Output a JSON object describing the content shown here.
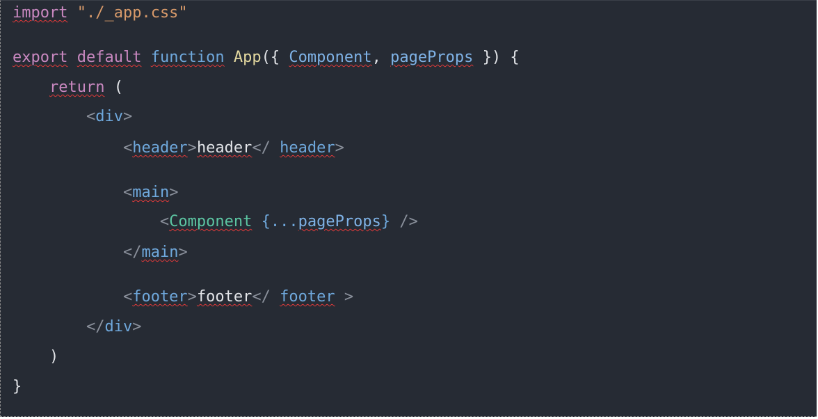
{
  "editor": {
    "colors": {
      "background": "#262b34",
      "keyword": "#c988c0",
      "function_name": "#e4d9a0",
      "string": "#d89a6a",
      "tag": "#6fa8dc",
      "component": "#5cc5a2",
      "punctuation": "#8a909b",
      "spellcheck_underline": "#e03a3a"
    },
    "lines": [
      {
        "tokens": [
          {
            "text": "import",
            "kind": "kw",
            "squiggle": true
          },
          {
            "text": " ",
            "kind": "plain"
          },
          {
            "text": "\"./_app.css\"",
            "kind": "str"
          }
        ]
      },
      {
        "tokens": []
      },
      {
        "tokens": [
          {
            "text": "export",
            "kind": "kw",
            "squiggle": true
          },
          {
            "text": " ",
            "kind": "plain"
          },
          {
            "text": "default",
            "kind": "kw",
            "squiggle": true
          },
          {
            "text": " ",
            "kind": "plain"
          },
          {
            "text": "function",
            "kind": "blue",
            "squiggle": true
          },
          {
            "text": " ",
            "kind": "plain"
          },
          {
            "text": "App",
            "kind": "fn"
          },
          {
            "text": "({ ",
            "kind": "plain"
          },
          {
            "text": "Component",
            "kind": "param",
            "squiggle": true
          },
          {
            "text": ", ",
            "kind": "plain"
          },
          {
            "text": "pageProps",
            "kind": "param",
            "squiggle": true
          },
          {
            "text": " }) {",
            "kind": "plain"
          }
        ]
      },
      {
        "tokens": [
          {
            "text": "    ",
            "kind": "plain"
          },
          {
            "text": "return",
            "kind": "kw",
            "squiggle": true
          },
          {
            "text": " (",
            "kind": "plain"
          }
        ]
      },
      {
        "tokens": [
          {
            "text": "        ",
            "kind": "plain"
          },
          {
            "text": "<",
            "kind": "punc"
          },
          {
            "text": "div",
            "kind": "blue"
          },
          {
            "text": ">",
            "kind": "punc"
          }
        ]
      },
      {
        "tokens": [
          {
            "text": "            ",
            "kind": "plain"
          },
          {
            "text": "<",
            "kind": "punc"
          },
          {
            "text": "header",
            "kind": "blue",
            "squiggle": true
          },
          {
            "text": ">",
            "kind": "punc"
          },
          {
            "text": "header",
            "kind": "plain",
            "squiggle": true
          },
          {
            "text": "</ ",
            "kind": "punc"
          },
          {
            "text": "header",
            "kind": "blue",
            "squiggle": true
          },
          {
            "text": ">",
            "kind": "punc"
          }
        ]
      },
      {
        "tokens": []
      },
      {
        "tokens": [
          {
            "text": "            ",
            "kind": "plain"
          },
          {
            "text": "<",
            "kind": "punc"
          },
          {
            "text": "main",
            "kind": "blue",
            "squiggle": true
          },
          {
            "text": ">",
            "kind": "punc"
          }
        ]
      },
      {
        "tokens": [
          {
            "text": "                ",
            "kind": "plain"
          },
          {
            "text": "<",
            "kind": "punc"
          },
          {
            "text": "Component",
            "kind": "comp",
            "squiggle": true
          },
          {
            "text": " ",
            "kind": "plain"
          },
          {
            "text": "{...",
            "kind": "blue"
          },
          {
            "text": "pageProps",
            "kind": "param",
            "squiggle": true
          },
          {
            "text": "}",
            "kind": "blue"
          },
          {
            "text": " />",
            "kind": "punc"
          }
        ]
      },
      {
        "tokens": [
          {
            "text": "            ",
            "kind": "plain"
          },
          {
            "text": "</",
            "kind": "punc"
          },
          {
            "text": "main",
            "kind": "blue",
            "squiggle": true
          },
          {
            "text": ">",
            "kind": "punc"
          }
        ]
      },
      {
        "tokens": []
      },
      {
        "tokens": [
          {
            "text": "            ",
            "kind": "plain"
          },
          {
            "text": "<",
            "kind": "punc"
          },
          {
            "text": "footer",
            "kind": "blue",
            "squiggle": true
          },
          {
            "text": ">",
            "kind": "punc"
          },
          {
            "text": "footer",
            "kind": "plain",
            "squiggle": true
          },
          {
            "text": "</ ",
            "kind": "punc"
          },
          {
            "text": "footer",
            "kind": "blue",
            "squiggle": true
          },
          {
            "text": " >",
            "kind": "punc"
          }
        ]
      },
      {
        "tokens": [
          {
            "text": "        ",
            "kind": "plain"
          },
          {
            "text": "</",
            "kind": "punc"
          },
          {
            "text": "div",
            "kind": "blue"
          },
          {
            "text": ">",
            "kind": "punc"
          }
        ]
      },
      {
        "tokens": [
          {
            "text": "    ",
            "kind": "plain"
          },
          {
            "text": ")",
            "kind": "plain"
          }
        ]
      },
      {
        "tokens": [
          {
            "text": "}",
            "kind": "plain"
          }
        ]
      }
    ]
  }
}
